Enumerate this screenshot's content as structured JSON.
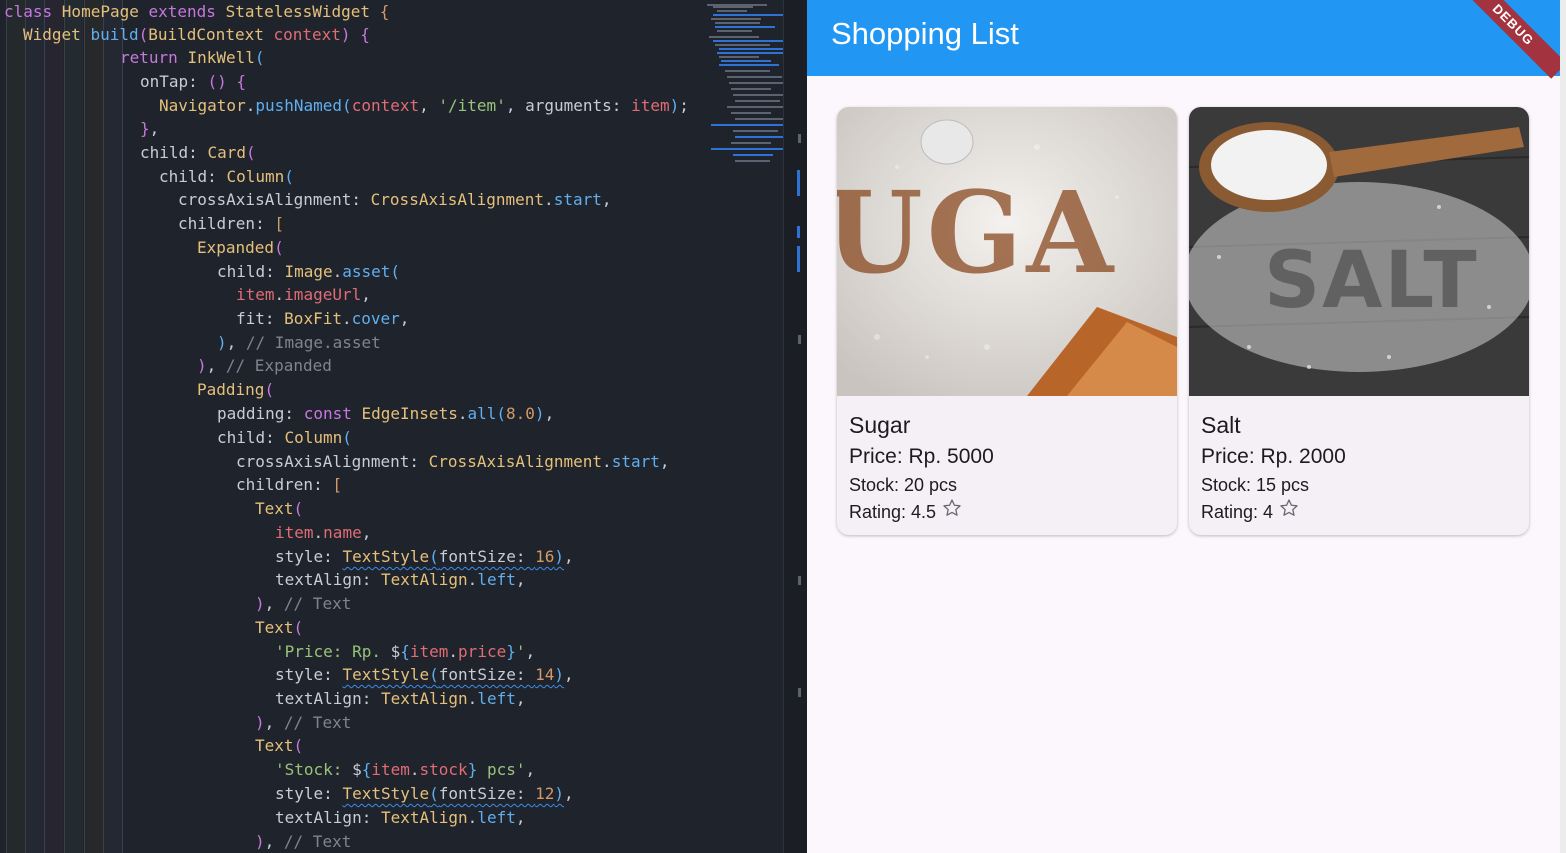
{
  "editor": {
    "lines": [
      [
        [
          "kw",
          "class "
        ],
        [
          "cls",
          "HomePage "
        ],
        [
          "kw",
          "extends "
        ],
        [
          "cls",
          "StatelessWidget "
        ],
        [
          "br1",
          "{"
        ]
      ],
      [
        [
          "cls",
          "Widget "
        ],
        [
          "fn",
          "build"
        ],
        [
          "br2",
          "("
        ],
        [
          "cls",
          "BuildContext "
        ],
        [
          "prop",
          "context"
        ],
        [
          "br2",
          ") "
        ],
        [
          "br2",
          "{"
        ]
      ],
      [
        [
          "kw",
          "return "
        ],
        [
          "cls",
          "InkWell"
        ],
        [
          "br3",
          "("
        ]
      ],
      [
        [
          "punc",
          "onTap: "
        ],
        [
          "br2",
          "() "
        ],
        [
          "br2",
          "{"
        ]
      ],
      [
        [
          "cls",
          "Navigator"
        ],
        [
          "punc",
          "."
        ],
        [
          "fn",
          "pushNamed"
        ],
        [
          "br3",
          "("
        ],
        [
          "prop",
          "context"
        ],
        [
          "punc",
          ", "
        ],
        [
          "str",
          "'/item'"
        ],
        [
          "punc",
          ", arguments: "
        ],
        [
          "prop",
          "item"
        ],
        [
          "br3",
          ")"
        ],
        [
          "punc",
          ";"
        ]
      ],
      [
        [
          "br2",
          "}"
        ],
        [
          "punc",
          ","
        ]
      ],
      [
        [
          "punc",
          "child: "
        ],
        [
          "cls",
          "Card"
        ],
        [
          "br2",
          "("
        ]
      ],
      [
        [
          "punc",
          "child: "
        ],
        [
          "cls",
          "Column"
        ],
        [
          "br3",
          "("
        ]
      ],
      [
        [
          "punc",
          "crossAxisAlignment: "
        ],
        [
          "cls",
          "CrossAxisAlignment"
        ],
        [
          "punc",
          "."
        ],
        [
          "fn",
          "start"
        ],
        [
          "punc",
          ","
        ]
      ],
      [
        [
          "punc",
          "children: "
        ],
        [
          "br1",
          "["
        ]
      ],
      [
        [
          "cls",
          "Expanded"
        ],
        [
          "br2",
          "("
        ]
      ],
      [
        [
          "punc",
          "child: "
        ],
        [
          "cls",
          "Image"
        ],
        [
          "punc",
          "."
        ],
        [
          "fn",
          "asset"
        ],
        [
          "br3",
          "("
        ]
      ],
      [
        [
          "prop",
          "item"
        ],
        [
          "punc",
          "."
        ],
        [
          "prop",
          "imageUrl"
        ],
        [
          "punc",
          ","
        ]
      ],
      [
        [
          "punc",
          "fit: "
        ],
        [
          "cls",
          "BoxFit"
        ],
        [
          "punc",
          "."
        ],
        [
          "fn",
          "cover"
        ],
        [
          "punc",
          ","
        ]
      ],
      [
        [
          "br3",
          ")"
        ],
        [
          "punc",
          ", "
        ],
        [
          "cm",
          "// Image.asset"
        ]
      ],
      [
        [
          "br2",
          ")"
        ],
        [
          "punc",
          ", "
        ],
        [
          "cm",
          "// Expanded"
        ]
      ],
      [
        [
          "cls",
          "Padding"
        ],
        [
          "br2",
          "("
        ]
      ],
      [
        [
          "punc",
          "padding: "
        ],
        [
          "kw",
          "const "
        ],
        [
          "cls",
          "EdgeInsets"
        ],
        [
          "punc",
          "."
        ],
        [
          "fn",
          "all"
        ],
        [
          "br3",
          "("
        ],
        [
          "num",
          "8.0"
        ],
        [
          "br3",
          ")"
        ],
        [
          "punc",
          ","
        ]
      ],
      [
        [
          "punc",
          "child: "
        ],
        [
          "cls",
          "Column"
        ],
        [
          "br3",
          "("
        ]
      ],
      [
        [
          "punc",
          "crossAxisAlignment: "
        ],
        [
          "cls",
          "CrossAxisAlignment"
        ],
        [
          "punc",
          "."
        ],
        [
          "fn",
          "start"
        ],
        [
          "punc",
          ","
        ]
      ],
      [
        [
          "punc",
          "children: "
        ],
        [
          "br1",
          "["
        ]
      ],
      [
        [
          "cls",
          "Text"
        ],
        [
          "br2",
          "("
        ]
      ],
      [
        [
          "prop",
          "item"
        ],
        [
          "punc",
          "."
        ],
        [
          "prop",
          "name"
        ],
        [
          "punc",
          ","
        ]
      ],
      [
        [
          "punc",
          "style: "
        ],
        [
          "cls sq",
          "TextStyle"
        ],
        [
          "br3 sq",
          "("
        ],
        [
          "punc sq",
          "fontSize: "
        ],
        [
          "num sq",
          "16"
        ],
        [
          "br3 sq",
          ")"
        ],
        [
          "punc",
          ","
        ]
      ],
      [
        [
          "punc",
          "textAlign: "
        ],
        [
          "cls",
          "TextAlign"
        ],
        [
          "punc",
          "."
        ],
        [
          "fn",
          "left"
        ],
        [
          "punc",
          ","
        ]
      ],
      [
        [
          "br2",
          ")"
        ],
        [
          "punc",
          ", "
        ],
        [
          "cm",
          "// Text"
        ]
      ],
      [
        [
          "cls",
          "Text"
        ],
        [
          "br2",
          "("
        ]
      ],
      [
        [
          "str",
          "'Price: Rp. "
        ],
        [
          "punc",
          "$"
        ],
        [
          "br3",
          "{"
        ],
        [
          "prop",
          "item"
        ],
        [
          "punc",
          "."
        ],
        [
          "prop",
          "price"
        ],
        [
          "br3",
          "}"
        ],
        [
          "str",
          "'"
        ],
        [
          "punc",
          ","
        ]
      ],
      [
        [
          "punc",
          "style: "
        ],
        [
          "cls sq",
          "TextStyle"
        ],
        [
          "br3 sq",
          "("
        ],
        [
          "punc sq",
          "fontSize: "
        ],
        [
          "num sq",
          "14"
        ],
        [
          "br3 sq",
          ")"
        ],
        [
          "punc",
          ","
        ]
      ],
      [
        [
          "punc",
          "textAlign: "
        ],
        [
          "cls",
          "TextAlign"
        ],
        [
          "punc",
          "."
        ],
        [
          "fn",
          "left"
        ],
        [
          "punc",
          ","
        ]
      ],
      [
        [
          "br2",
          ")"
        ],
        [
          "punc",
          ", "
        ],
        [
          "cm",
          "// Text"
        ]
      ],
      [
        [
          "cls",
          "Text"
        ],
        [
          "br2",
          "("
        ]
      ],
      [
        [
          "str",
          "'Stock: "
        ],
        [
          "punc",
          "$"
        ],
        [
          "br3",
          "{"
        ],
        [
          "prop",
          "item"
        ],
        [
          "punc",
          "."
        ],
        [
          "prop",
          "stock"
        ],
        [
          "br3",
          "}"
        ],
        [
          "str",
          " pcs'"
        ],
        [
          "punc",
          ","
        ]
      ],
      [
        [
          "punc",
          "style: "
        ],
        [
          "cls sq",
          "TextStyle"
        ],
        [
          "br3 sq",
          "("
        ],
        [
          "punc sq",
          "fontSize: "
        ],
        [
          "num sq",
          "12"
        ],
        [
          "br3 sq",
          ")"
        ],
        [
          "punc",
          ","
        ]
      ],
      [
        [
          "punc",
          "textAlign: "
        ],
        [
          "cls",
          "TextAlign"
        ],
        [
          "punc",
          "."
        ],
        [
          "fn",
          "left"
        ],
        [
          "punc",
          ","
        ]
      ],
      [
        [
          "br2",
          ")"
        ],
        [
          "punc",
          ", "
        ],
        [
          "cm",
          "// Text"
        ]
      ]
    ]
  },
  "app": {
    "title": "Shopping List",
    "debug_label": "DEBUG",
    "appbar_color": "#2196f3",
    "items": [
      {
        "name": "Sugar",
        "price": "Price: Rp. 5000",
        "stock": "Stock: 20 pcs",
        "rating": "Rating: 4.5",
        "image_word": "UGA",
        "image_icon": "sugar-photo-icon"
      },
      {
        "name": "Salt",
        "price": "Price: Rp. 2000",
        "stock": "Stock: 15 pcs",
        "rating": "Rating: 4",
        "image_word": "SALT",
        "image_icon": "salt-photo-icon"
      }
    ]
  }
}
